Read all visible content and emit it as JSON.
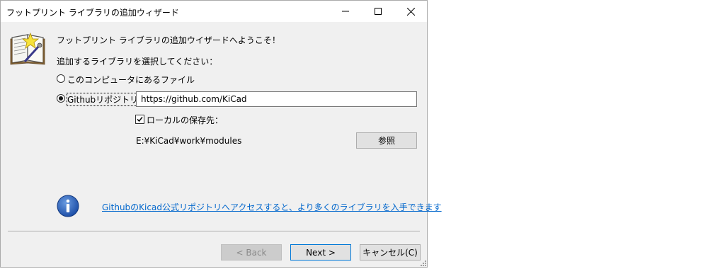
{
  "window": {
    "title": "フットプリント ライブラリの追加ウィザード"
  },
  "wizard": {
    "heading": "フットプリント ライブラリの追加ウイザードへようこそ！",
    "prompt": "追加するライブラリを選択してください：",
    "option_local": "このコンピュータにあるファイル",
    "option_github": "Githubリポジトリ",
    "github_url": "https://github.com/KiCad",
    "local_copy_label": "ローカルの保存先：",
    "local_copy_checked": true,
    "local_path": "E:¥KiCad¥work¥modules",
    "browse_label": "参照",
    "info_link": "GithubのKicad公式リポジトリへアクセスすると、より多くのライブラリを入手できます"
  },
  "buttons": {
    "back": "< Back",
    "next": "Next >",
    "cancel": "キャンセル(C)"
  }
}
